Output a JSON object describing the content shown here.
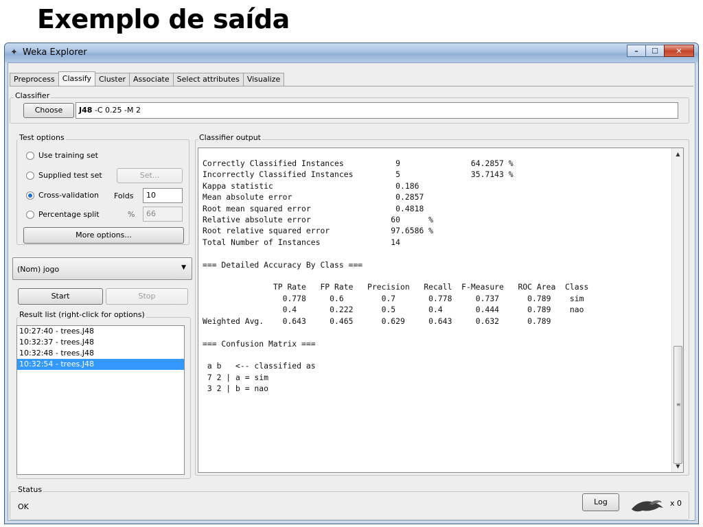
{
  "slide_title": "Exemplo de saída",
  "window": {
    "title": "Weka Explorer",
    "controls": {
      "minimize": "–",
      "maximize": "☐",
      "close": "✕"
    }
  },
  "tabs": [
    {
      "label": "Preprocess"
    },
    {
      "label": "Classify"
    },
    {
      "label": "Cluster"
    },
    {
      "label": "Associate"
    },
    {
      "label": "Select attributes"
    },
    {
      "label": "Visualize"
    }
  ],
  "classifier": {
    "group_label": "Classifier",
    "choose_label": "Choose",
    "name": "J48",
    "options": " -C 0.25 -M 2"
  },
  "test_options": {
    "group_label": "Test options",
    "use_training_set": "Use training set",
    "supplied_test_set": "Supplied test set",
    "set_button": "Set...",
    "cross_validation": "Cross-validation",
    "folds_label": "Folds",
    "folds_value": "10",
    "percentage_split": "Percentage split",
    "percent_symbol": "%",
    "percent_value": "66",
    "more_options": "More options...",
    "selected": "cross_validation"
  },
  "class_attribute": "(Nom) jogo",
  "start_label": "Start",
  "stop_label": "Stop",
  "result_list": {
    "label": "Result list (right-click for options)",
    "items": [
      {
        "text": "10:27:40 - trees.J48",
        "selected": false
      },
      {
        "text": "10:32:37 - trees.J48",
        "selected": false
      },
      {
        "text": "10:32:48 - trees.J48",
        "selected": false
      },
      {
        "text": "10:32:54 - trees.J48",
        "selected": true
      }
    ]
  },
  "output": {
    "label": "Classifier output",
    "text": "Correctly Classified Instances           9               64.2857 %\nIncorrectly Classified Instances         5               35.7143 %\nKappa statistic                          0.186\nMean absolute error                      0.2857\nRoot mean squared error                  0.4818\nRelative absolute error                 60      %\nRoot relative squared error             97.6586 %\nTotal Number of Instances               14\n\n=== Detailed Accuracy By Class ===\n\n               TP Rate   FP Rate   Precision   Recall  F-Measure   ROC Area  Class\n                 0.778     0.6        0.7       0.778     0.737      0.789    sim\n                 0.4       0.222      0.5       0.4       0.444      0.789    nao\nWeighted Avg.    0.643     0.465      0.629     0.643     0.632      0.789\n\n=== Confusion Matrix ===\n\n a b   <-- classified as\n 7 2 | a = sim\n 3 2 | b = nao"
  },
  "status": {
    "group_label": "Status",
    "text": "OK",
    "log_label": "Log",
    "count": "x 0"
  }
}
